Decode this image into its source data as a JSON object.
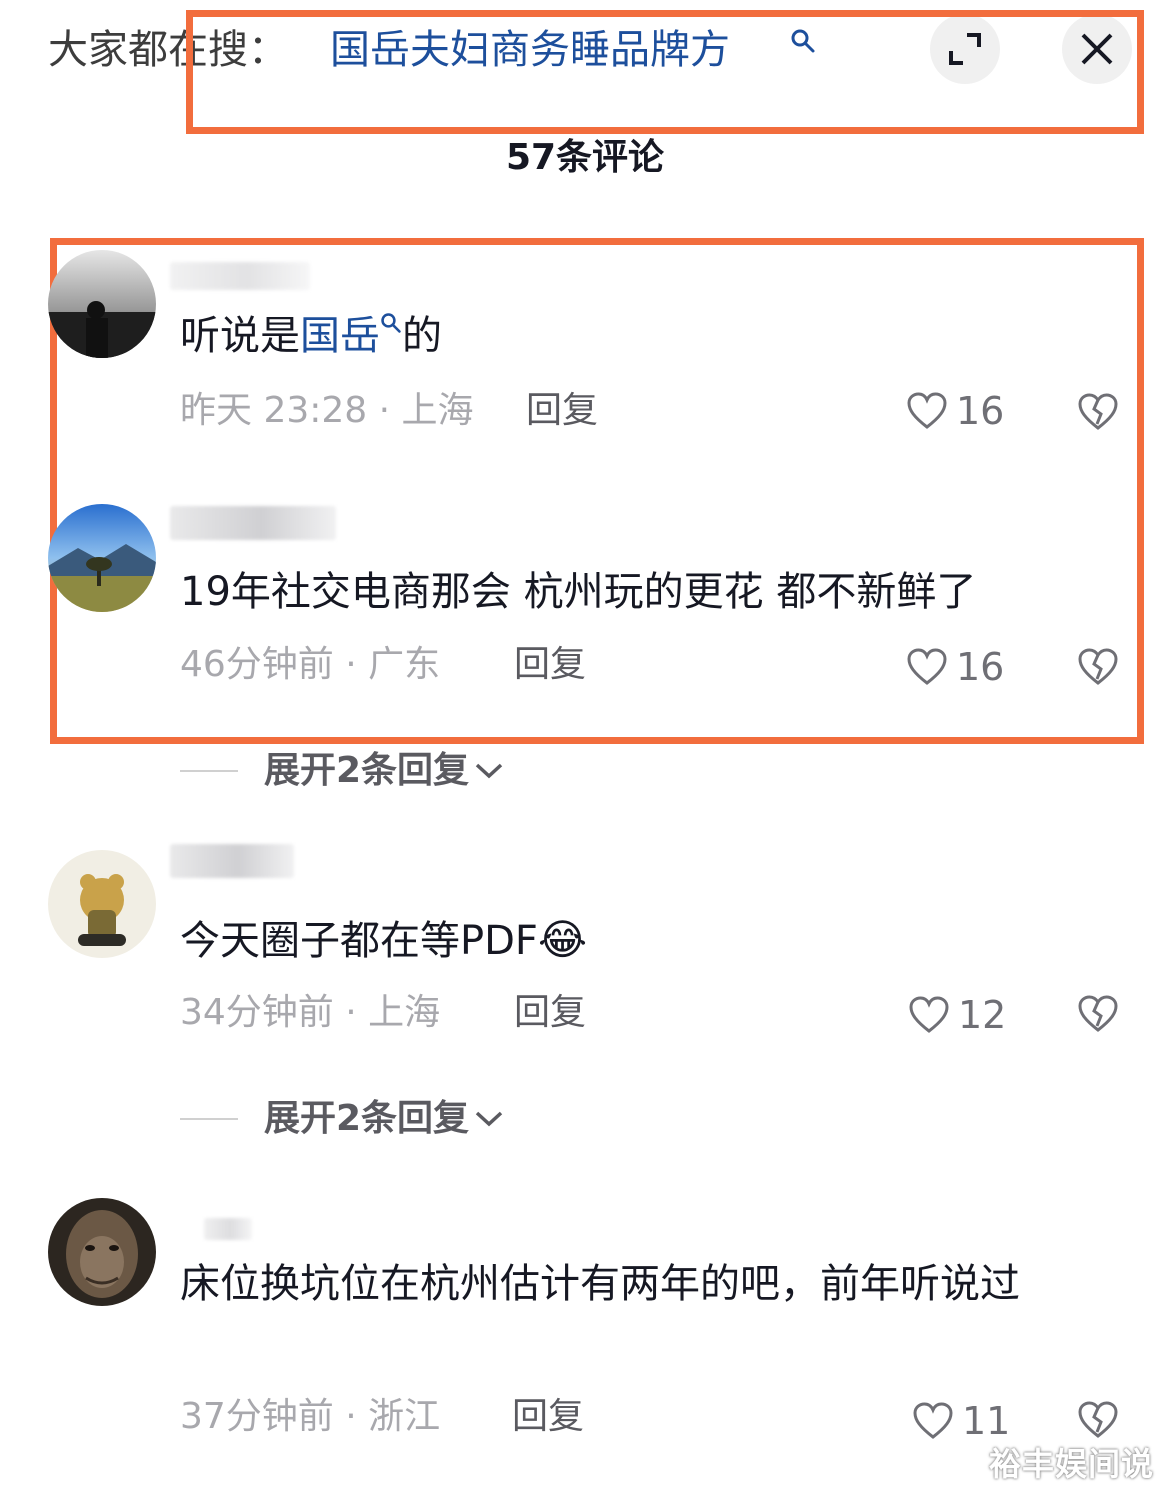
{
  "search": {
    "prefix": "大家都在搜：",
    "term": "国岳夫妇商务睡品牌方"
  },
  "header": {
    "comment_count_title": "57条评论"
  },
  "comments": [
    {
      "text_before": "听说是",
      "tag": "国岳",
      "text_after": "的",
      "time": "昨天 23:28",
      "location": "上海",
      "reply_label": "回复",
      "likes": "16"
    },
    {
      "text": "19年社交电商那会 杭州玩的更花 都不新鲜了",
      "time": "46分钟前",
      "location": "广东",
      "reply_label": "回复",
      "likes": "16",
      "expand_label": "展开2条回复"
    },
    {
      "text": "今天圈子都在等PDF",
      "emoji": "😂",
      "time": "34分钟前",
      "location": "上海",
      "reply_label": "回复",
      "likes": "12",
      "expand_label": "展开2条回复"
    },
    {
      "text": "床位换坑位在杭州估计有两年的吧，前年听说过",
      "time": "37分钟前",
      "location": "浙江",
      "reply_label": "回复",
      "likes": "11"
    }
  ],
  "watermark": "裕丰娱间说",
  "colors": {
    "highlight": "#f26d3d",
    "search_term": "#1d4f9c",
    "meta_text": "#a8a8ad"
  },
  "icons": [
    "search-icon",
    "expand-icon",
    "close-icon",
    "heart-icon",
    "broken-heart-icon",
    "chevron-down-icon"
  ]
}
